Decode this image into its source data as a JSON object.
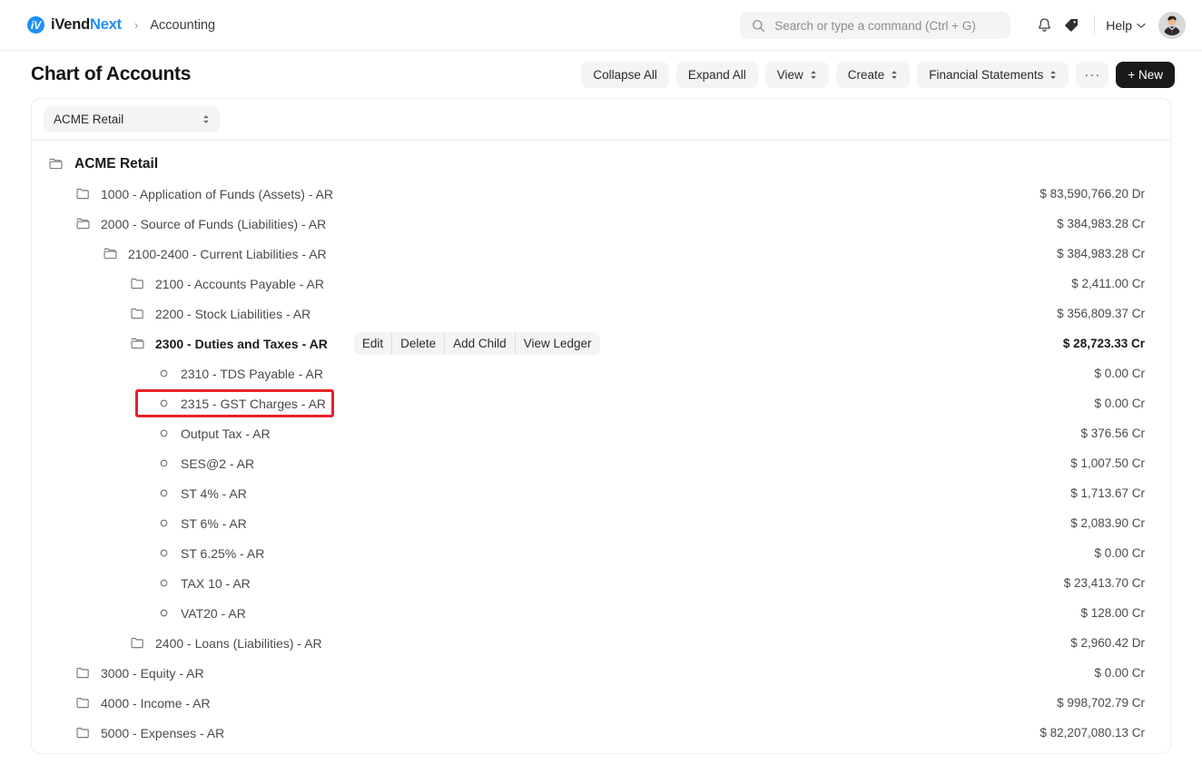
{
  "navbar": {
    "brand_first": "iVend",
    "brand_second": "Next",
    "breadcrumb_sep": "›",
    "breadcrumb": "Accounting",
    "search_placeholder": "Search or type a command (Ctrl + G)",
    "help_label": "Help"
  },
  "page": {
    "title": "Chart of Accounts",
    "buttons": {
      "collapse_all": "Collapse All",
      "expand_all": "Expand All",
      "view": "View",
      "create": "Create",
      "financial_statements": "Financial Statements",
      "more": "···",
      "new": "+  New"
    }
  },
  "company_select": {
    "value": "ACME Retail"
  },
  "row_actions": {
    "edit": "Edit",
    "delete": "Delete",
    "add_child": "Add Child",
    "view_ledger": "View Ledger"
  },
  "highlight_color": "#e8222a",
  "tree": [
    {
      "label": "ACME Retail",
      "amount": "",
      "depth": 0,
      "icon": "folder-open",
      "style": "root"
    },
    {
      "label": "1000 - Application of Funds (Assets) - AR",
      "amount": "$ 83,590,766.20 Dr",
      "depth": 1,
      "icon": "folder-closed",
      "style": "normal"
    },
    {
      "label": "2000 - Source of Funds (Liabilities) - AR",
      "amount": "$ 384,983.28 Cr",
      "depth": 1,
      "icon": "folder-open",
      "style": "normal"
    },
    {
      "label": "2100-2400 - Current Liabilities - AR",
      "amount": "$ 384,983.28 Cr",
      "depth": 2,
      "icon": "folder-open",
      "style": "normal"
    },
    {
      "label": "2100 - Accounts Payable - AR",
      "amount": "$ 2,411.00 Cr",
      "depth": 3,
      "icon": "folder-closed",
      "style": "normal"
    },
    {
      "label": "2200 - Stock Liabilities - AR",
      "amount": "$ 356,809.37 Cr",
      "depth": 3,
      "icon": "folder-closed",
      "style": "normal"
    },
    {
      "label": "2300 - Duties and Taxes - AR",
      "amount": "$ 28,723.33 Cr",
      "depth": 3,
      "icon": "folder-open",
      "style": "bold",
      "actions": true
    },
    {
      "label": "2310 - TDS Payable - AR",
      "amount": "$ 0.00 Cr",
      "depth": 4,
      "icon": "dot",
      "style": "normal"
    },
    {
      "label": "2315 - GST Charges - AR",
      "amount": "$ 0.00 Cr",
      "depth": 4,
      "icon": "dot",
      "style": "normal",
      "highlight": true
    },
    {
      "label": "Output Tax - AR",
      "amount": "$ 376.56 Cr",
      "depth": 4,
      "icon": "dot",
      "style": "normal"
    },
    {
      "label": "SES@2 - AR",
      "amount": "$ 1,007.50 Cr",
      "depth": 4,
      "icon": "dot",
      "style": "normal"
    },
    {
      "label": "ST 4% - AR",
      "amount": "$ 1,713.67 Cr",
      "depth": 4,
      "icon": "dot",
      "style": "normal"
    },
    {
      "label": "ST 6% - AR",
      "amount": "$ 2,083.90 Cr",
      "depth": 4,
      "icon": "dot",
      "style": "normal"
    },
    {
      "label": "ST 6.25% - AR",
      "amount": "$ 0.00 Cr",
      "depth": 4,
      "icon": "dot",
      "style": "normal"
    },
    {
      "label": "TAX 10 - AR",
      "amount": "$ 23,413.70 Cr",
      "depth": 4,
      "icon": "dot",
      "style": "normal"
    },
    {
      "label": "VAT20 - AR",
      "amount": "$ 128.00 Cr",
      "depth": 4,
      "icon": "dot",
      "style": "normal"
    },
    {
      "label": "2400 - Loans (Liabilities) - AR",
      "amount": "$ 2,960.42 Dr",
      "depth": 3,
      "icon": "folder-closed",
      "style": "normal"
    },
    {
      "label": "3000 - Equity - AR",
      "amount": "$ 0.00 Cr",
      "depth": 1,
      "icon": "folder-closed",
      "style": "normal"
    },
    {
      "label": "4000 - Income - AR",
      "amount": "$ 998,702.79 Cr",
      "depth": 1,
      "icon": "folder-closed",
      "style": "normal"
    },
    {
      "label": "5000 - Expenses - AR",
      "amount": "$ 82,207,080.13 Cr",
      "depth": 1,
      "icon": "folder-closed",
      "style": "normal"
    }
  ]
}
